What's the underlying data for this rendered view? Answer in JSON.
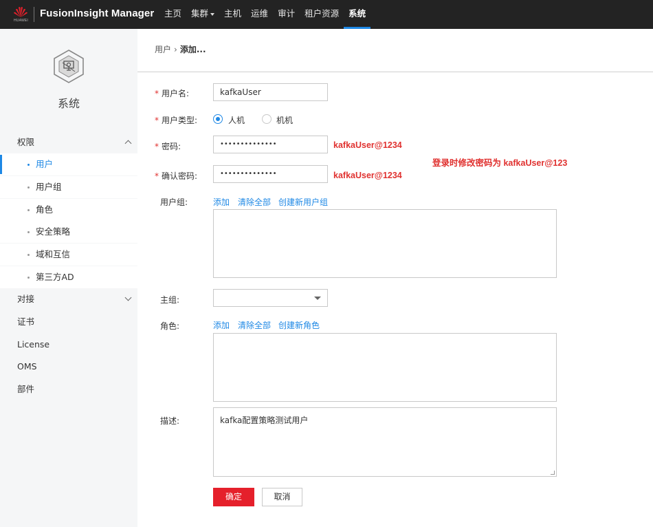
{
  "app": {
    "logo_text": "HUAWEI",
    "brand": "FusionInsight Manager"
  },
  "nav": [
    {
      "label": "主页"
    },
    {
      "label": "集群"
    },
    {
      "label": "主机"
    },
    {
      "label": "运维"
    },
    {
      "label": "审计"
    },
    {
      "label": "租户资源"
    },
    {
      "label": "系统"
    }
  ],
  "sidebar": {
    "title": "系统",
    "groups": {
      "permission": "权限",
      "connect": "对接",
      "cert": "证书",
      "license": "License",
      "oms": "OMS",
      "component": "部件"
    },
    "sub_items": [
      {
        "label": "用户"
      },
      {
        "label": "用户组"
      },
      {
        "label": "角色"
      },
      {
        "label": "安全策略"
      },
      {
        "label": "域和互信"
      },
      {
        "label": "第三方AD"
      }
    ]
  },
  "breadcrumb": {
    "parent": "用户",
    "current": "添加..."
  },
  "form": {
    "username_label": "用户名:",
    "username_value": "kafkaUser",
    "usertype_label": "用户类型:",
    "usertype_human": "人机",
    "usertype_machine": "机机",
    "password_label": "密码:",
    "password_value": "••••••••••••••",
    "confirm_label": "确认密码:",
    "confirm_value": "••••••••••••••",
    "usergroup_label": "用户组:",
    "maingroup_label": "主组:",
    "maingroup_value": "",
    "role_label": "角色:",
    "desc_label": "描述:",
    "desc_value": "kafka配置策略测试用户",
    "add_link": "添加",
    "clear_link": "清除全部",
    "create_group_link": "创建新用户组",
    "create_role_link": "创建新角色",
    "ok_button": "确定",
    "cancel_button": "取消"
  },
  "annotations": {
    "password_hint": "kafkaUser@1234",
    "confirm_hint": "kafkaUser@1234",
    "login_hint": "登录时修改密码为 kafkaUser@123"
  },
  "colors": {
    "topbar": "#232323",
    "accent": "#1e88e5",
    "primary_button": "#e5202b",
    "annotation": "#e0312f"
  }
}
